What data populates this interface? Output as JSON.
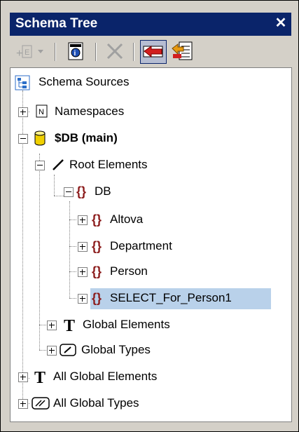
{
  "window": {
    "title": "Schema Tree",
    "close_label": "✕"
  },
  "toolbar": {
    "buttons": [
      {
        "name": "add-element-dropdown-button",
        "icon": "add-element-icon"
      },
      {
        "name": "properties-button",
        "icon": "properties-icon"
      },
      {
        "name": "delete-button",
        "icon": "delete-icon"
      },
      {
        "name": "insert-back-button",
        "icon": "arrow-left-icon",
        "active": true
      },
      {
        "name": "remove-button",
        "icon": "list-arrow-icon"
      }
    ]
  },
  "tree": {
    "root": "Schema Sources",
    "namespaces": "Namespaces",
    "db_main": "$DB (main)",
    "root_elements": "Root Elements",
    "db": "DB",
    "altova": "Altova",
    "department": "Department",
    "person": "Person",
    "select_for_person": "SELECT_For_Person1",
    "global_elements": "Global Elements",
    "global_types": "Global Types",
    "all_global_elements": "All Global Elements",
    "all_global_types": "All Global Types"
  },
  "colors": {
    "titlebar": "#0a246a",
    "selection": "#b9d1ea",
    "element_icon": "#8b1a1a",
    "db_icon": "#f0d000"
  }
}
